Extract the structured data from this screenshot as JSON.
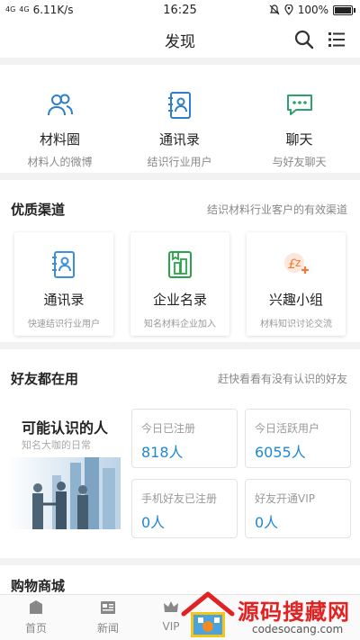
{
  "statusbar": {
    "signal1": "4G",
    "signal2": "4G",
    "speed": "6.11K/s",
    "time": "16:25",
    "battery": "100%",
    "battery_level": 1.0
  },
  "header": {
    "title": "发现",
    "search_icon": "search-icon",
    "menu_icon": "list-menu-icon"
  },
  "quick_links": [
    {
      "title": "材料圈",
      "subtitle": "材料人的微博",
      "icon": "people-icon"
    },
    {
      "title": "通讯录",
      "subtitle": "结识行业用户",
      "icon": "contact-book-icon"
    },
    {
      "title": "聊天",
      "subtitle": "与好友聊天",
      "icon": "chat-bubble-icon"
    }
  ],
  "channels": {
    "title": "优质渠道",
    "subtitle": "结识材料行业客户的有效渠道",
    "cards": [
      {
        "title": "通讯录",
        "subtitle": "快速结识行业用户",
        "icon": "contact-book-icon",
        "color": "#3a8fd6"
      },
      {
        "title": "企业名录",
        "subtitle": "知名材料企业加入",
        "icon": "company-directory-icon",
        "color": "#2aa44a"
      },
      {
        "title": "兴趣小组",
        "subtitle": "材料知识讨论交流",
        "icon": "interest-group-icon",
        "color": "#f07a3a"
      }
    ]
  },
  "friends": {
    "title": "好友都在用",
    "subtitle": "赶快看看有没有认识的好友",
    "promo_title": "可能认识的人",
    "promo_subtitle": "知名大咖的日常",
    "stats": [
      {
        "label": "今日已注册",
        "value": "818人"
      },
      {
        "label": "今日活跃用户",
        "value": "6055人"
      },
      {
        "label": "手机好友已注册",
        "value": "0人"
      },
      {
        "label": "好友开通VIP",
        "value": "0人"
      }
    ]
  },
  "shop": {
    "title": "购物商城"
  },
  "tabbar": [
    {
      "label": "首页",
      "icon": "home-icon"
    },
    {
      "label": "新闻",
      "icon": "news-icon"
    },
    {
      "label": "VIP",
      "icon": "vip-crown-icon"
    }
  ],
  "watermark": {
    "text": "源码搜藏网",
    "url": "codesocang.com"
  },
  "colors": {
    "accent_blue": "#1e88d2",
    "watermark_red": "#e02222"
  }
}
